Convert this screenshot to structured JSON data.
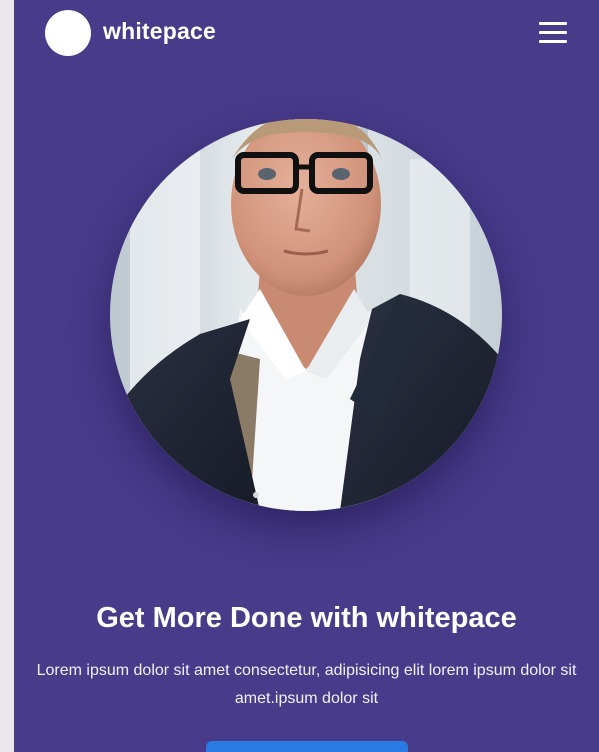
{
  "header": {
    "brand_name": "whitepace",
    "logo_icon": "logo-circle-icon",
    "menu_icon": "hamburger-menu-icon"
  },
  "hero": {
    "image_subject": "portrait photo",
    "headline": "Get More Done with whitepace",
    "description": "Lorem ipsum dolor sit amet consectetur, adipisicing elit lorem ipsum dolor sit amet.ipsum dolor sit",
    "cta_label": ""
  },
  "colors": {
    "background": "#473b8a",
    "text": "#ffffff",
    "button": "#2a7ae4",
    "outer": "#ede5ec"
  }
}
